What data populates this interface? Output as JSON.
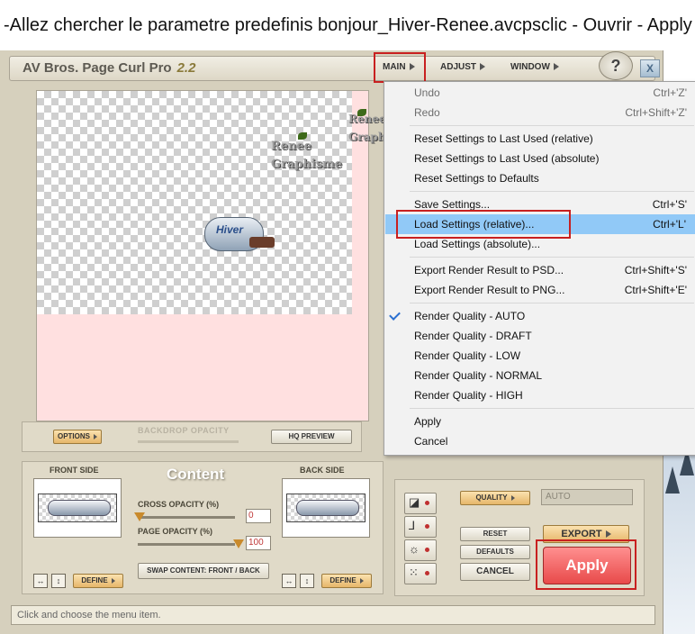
{
  "caption": "-Allez chercher le parametre predefinis bonjour_Hiver-Renee.avcpsclic - Ouvrir  - Apply",
  "app": {
    "name": "AV Bros. Page Curl Pro",
    "version": "2.2"
  },
  "menubar": {
    "main": "MAIN",
    "adjust": "ADJUST",
    "window": "WINDOW",
    "help": "?",
    "close": "X"
  },
  "preview": {
    "watermark_small": [
      "Renee",
      "Graphisme"
    ],
    "watermark_large": [
      "Renee",
      "Graphisme"
    ],
    "curl_text": "Hiver"
  },
  "preview_controls": {
    "options": "OPTIONS",
    "backdrop_opacity": "BACKDROP OPACITY",
    "hq_preview": "HQ PREVIEW"
  },
  "content": {
    "title": "Content",
    "front_side": "FRONT SIDE",
    "back_side": "BACK SIDE",
    "cross_opacity_label": "CROSS OPACITY (%)",
    "cross_opacity_value": "0",
    "page_opacity_label": "PAGE OPACITY (%)",
    "page_opacity_value": "100",
    "swap_button": "SWAP CONTENT: FRONT / BACK",
    "define": "DEFINE",
    "icon_h": "↔",
    "icon_v": "↕"
  },
  "right_panel": {
    "quality_label": "QUALITY",
    "quality_value": "AUTO",
    "reset": "RESET",
    "defaults": "DEFAULTS",
    "cancel": "CANCEL",
    "export": "EXPORT",
    "apply": "Apply"
  },
  "status_bar": "Click and choose the menu item.",
  "menu": {
    "items": [
      {
        "label": "Undo",
        "shortcut": "Ctrl+'Z'"
      },
      {
        "label": "Redo",
        "shortcut": "Ctrl+Shift+'Z'"
      },
      {
        "label": "Reset Settings to Last Used (relative)",
        "shortcut": ""
      },
      {
        "label": "Reset Settings to Last Used (absolute)",
        "shortcut": ""
      },
      {
        "label": "Reset Settings to Defaults",
        "shortcut": ""
      },
      {
        "label": "Save Settings...",
        "shortcut": "Ctrl+'S'"
      },
      {
        "label": "Load Settings (relative)...",
        "shortcut": "Ctrl+'L'"
      },
      {
        "label": "Load Settings (absolute)...",
        "shortcut": ""
      },
      {
        "label": "Export Render Result to PSD...",
        "shortcut": "Ctrl+Shift+'S'"
      },
      {
        "label": "Export Render Result to PNG...",
        "shortcut": "Ctrl+Shift+'E'"
      },
      {
        "label": "Render Quality - AUTO",
        "shortcut": ""
      },
      {
        "label": "Render Quality - DRAFT",
        "shortcut": ""
      },
      {
        "label": "Render Quality - LOW",
        "shortcut": ""
      },
      {
        "label": "Render Quality - NORMAL",
        "shortcut": ""
      },
      {
        "label": "Render Quality - HIGH",
        "shortcut": ""
      },
      {
        "label": "Apply",
        "shortcut": ""
      },
      {
        "label": "Cancel",
        "shortcut": ""
      }
    ]
  },
  "colors": {
    "highlight": "#91c9f7",
    "annotation_red": "#c82020",
    "apply_button": "#e84a4a"
  }
}
